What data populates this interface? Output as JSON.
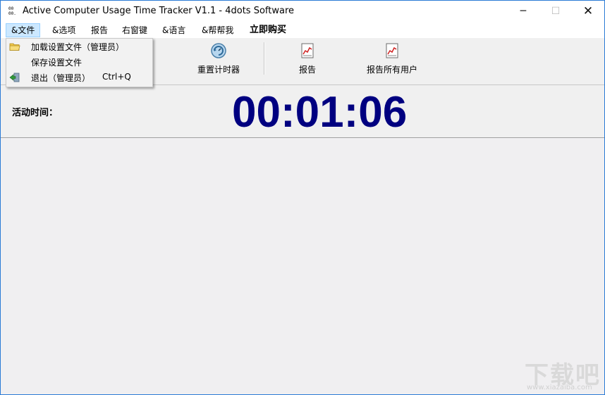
{
  "window": {
    "title": "Active Computer Usage Time Tracker V1.1 - 4dots Software",
    "minimize": "─",
    "maximize": "☐",
    "close": "✕"
  },
  "menubar": {
    "items": [
      {
        "label": "&文件",
        "active": true
      },
      {
        "label": "&选项"
      },
      {
        "label": "报告"
      },
      {
        "label": "右窗键"
      },
      {
        "label": "&语言"
      },
      {
        "label": "&帮帮我"
      },
      {
        "label": "立即购买",
        "bold": true
      }
    ]
  },
  "file_menu": {
    "items": [
      {
        "label": "加载设置文件（管理员）",
        "icon": "folder-icon"
      },
      {
        "label": "保存设置文件",
        "icon": ""
      },
      {
        "label": "退出（管理员）",
        "shortcut": "Ctrl+Q",
        "icon": "exit-icon"
      }
    ]
  },
  "toolbar": {
    "reset_timer_label": "重置计时器",
    "report_label": "报告",
    "report_all_users_label": "报告所有用户"
  },
  "timer": {
    "label": "活动时间：",
    "value": "00:01:06",
    "color": "#000080"
  },
  "watermark": {
    "text": "下载吧",
    "url": "www.xiazaiba.com"
  },
  "colors": {
    "menu_active_bg": "#cce8ff",
    "window_border": "#2b7bd6",
    "timer": "#000080"
  }
}
